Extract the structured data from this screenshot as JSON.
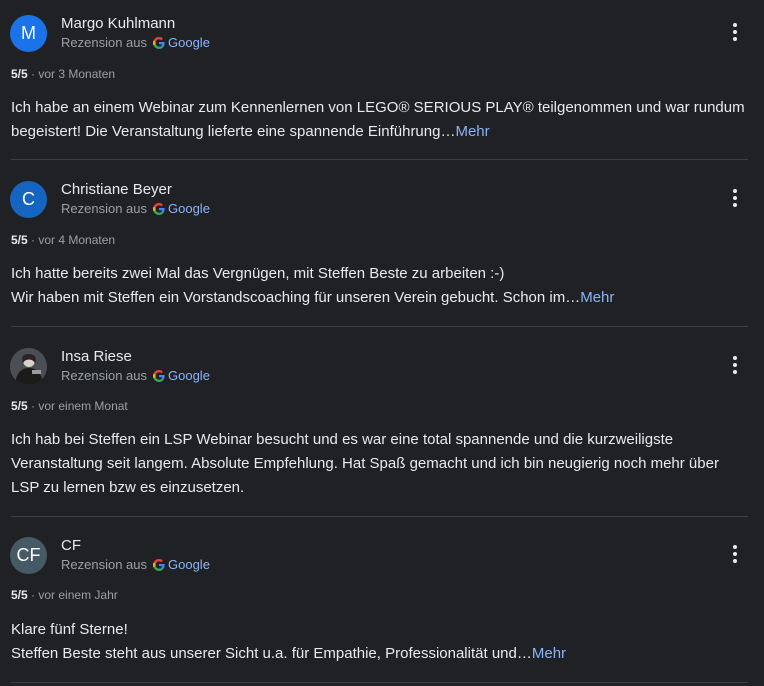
{
  "source_prefix": "Rezension aus",
  "source_name": "Google",
  "more_label": "Mehr",
  "colors": {
    "background": "#202124",
    "link": "#8ab4f8",
    "muted": "#9aa0a6",
    "google_blue": "#4285F4",
    "google_red": "#EA4335",
    "google_yellow": "#FBBC05",
    "google_green": "#34A853"
  },
  "reviews": [
    {
      "author": "Margo Kuhlmann",
      "avatar_letter": "M",
      "avatar_color": "#1a73e8",
      "rating": "5/5",
      "time": "vor 3 Monaten",
      "paragraphs": [
        "Ich habe an einem Webinar zum Kennenlernen von LEGO® SERIOUS PLAY® teilgenommen und war rundum begeistert! Die Veranstaltung lieferte eine spannende Einführung…"
      ],
      "truncated": true
    },
    {
      "author": "Christiane Beyer",
      "avatar_letter": "C",
      "avatar_color": "#1565c0",
      "rating": "5/5",
      "time": "vor 4 Monaten",
      "paragraphs": [
        "Ich hatte bereits zwei Mal das Vergnügen, mit Steffen Beste zu arbeiten :-)",
        "Wir haben mit Steffen ein Vorstandscoaching für unseren Verein gebucht. Schon im…"
      ],
      "truncated": true
    },
    {
      "author": "Insa Riese",
      "avatar_letter": "",
      "avatar_color": "#3c4043",
      "rating": "5/5",
      "time": "vor einem Monat",
      "paragraphs": [
        "Ich hab bei Steffen ein LSP Webinar besucht und es war eine total spannende und die kurzweiligste Veranstaltung seit langem. Absolute Empfehlung. Hat Spaß gemacht und ich bin neugierig noch mehr über LSP zu lernen bzw es einzusetzen."
      ],
      "truncated": false
    },
    {
      "author": "CF",
      "avatar_letter": "CF",
      "avatar_color": "#455a64",
      "rating": "5/5",
      "time": "vor einem Jahr",
      "paragraphs": [
        "Klare fünf Sterne!",
        "Steffen Beste steht aus unserer Sicht u.a. für Empathie, Professionalität und…"
      ],
      "truncated": true
    }
  ]
}
